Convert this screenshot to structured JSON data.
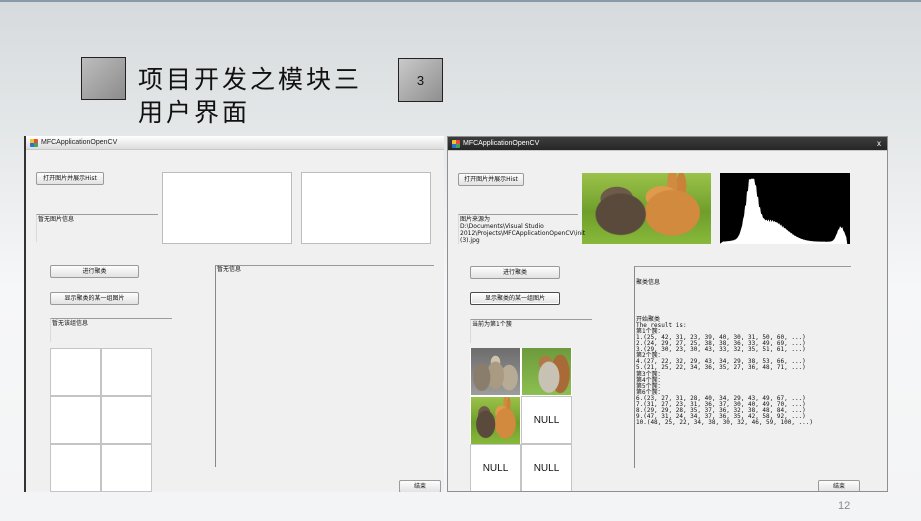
{
  "slide": {
    "title_line1": "项目开发之模块三",
    "title_line2": "用户界面",
    "badge": "3",
    "page_number": "12"
  },
  "left_window": {
    "title": "MFCApplicationOpenCV",
    "open_button": "打开图片并展示Hist",
    "image_info": "暂无图片信息",
    "cluster_button": "进行聚类",
    "show_group_button": "显示聚类的某一组图片",
    "group_info": "暂无该组信息",
    "result_info": "暂无信息",
    "end_button": "结束"
  },
  "right_window": {
    "title": "MFCApplicationOpenCV",
    "close_glyph": "x",
    "open_button": "打开图片并展示Hist",
    "image_source_label": "图片来源为",
    "image_path": "D:\\Documents\\Visual Studio 2012\\Projects\\MFCApplicationOpenCV\\init (3).jpg",
    "cluster_button": "进行聚类",
    "show_group_button": "显示聚类的某一组图片",
    "current_group": "当前为第1个簇",
    "null_labels": [
      "NULL",
      "NULL",
      "NULL"
    ],
    "cluster_info": {
      "header": "聚类信息",
      "lines": [
        "开始聚类",
        "The result is:",
        "第1个簇：",
        "1.(25, 42, 31, 23, 39, 40, 30, 31, 50, 60, ...)",
        "2.(24, 29, 27, 25, 38, 38, 36, 33, 49, 69, ...)",
        "3.(29, 30, 23, 30, 43, 33, 32, 35, 51, 61, ...)",
        "第2个簇：",
        "4.(27, 22, 32, 29, 43, 34, 29, 38, 53, 66, ...)",
        "5.(21, 25, 22, 34, 36, 35, 27, 36, 48, 71, ...)",
        "第3个簇：",
        "第4个簇：",
        "第5个簇：",
        "第6个簇：",
        "6.(23, 27, 31, 28, 40, 34, 29, 43, 49, 67, ...)",
        "7.(31, 27, 23, 31, 36, 37, 30, 40, 49, 70, ...)",
        "8.(29, 29, 28, 35, 37, 36, 32, 38, 48, 84, ...)",
        "9.(47, 31, 24, 34, 37, 36, 35, 42, 58, 92, ...)",
        "10.(48, 25, 22, 34, 38, 30, 32, 46, 59, 100, ...)"
      ]
    },
    "end_button": "结束"
  },
  "colors": {
    "background": "#f3f4f5",
    "window_bg": "#f0f0f0",
    "dark_titlebar": "#2c2c2c",
    "histogram": "#ffffff"
  },
  "icons": [
    "app-icon",
    "close-icon"
  ]
}
